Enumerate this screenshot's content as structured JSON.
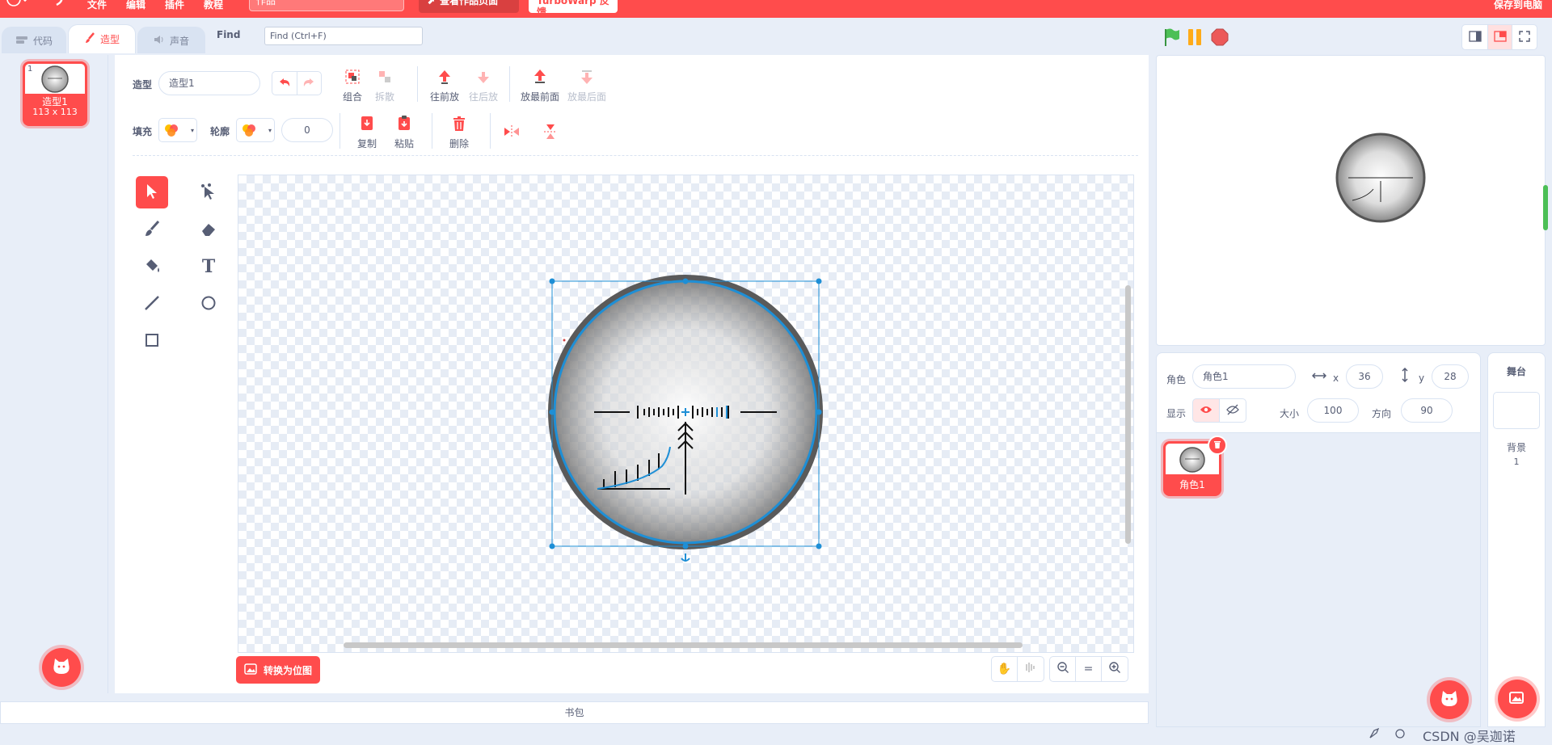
{
  "menu": {
    "items": [
      "文件",
      "编辑",
      "插件",
      "教程"
    ],
    "project_title": "作品",
    "see_project_label": "查看作品页面",
    "feedback_label": "TurboWarp 反馈",
    "save_label": "保存到电脑",
    "accent_color": "#ff4c4c"
  },
  "tabs": [
    {
      "label": "代码",
      "icon": "code-icon"
    },
    {
      "label": "造型",
      "icon": "brush-icon",
      "active": true
    },
    {
      "label": "声音",
      "icon": "speaker-icon"
    }
  ],
  "find": {
    "label": "Find",
    "placeholder": "Find (Ctrl+F)"
  },
  "costumes": [
    {
      "index": "1",
      "name": "造型1",
      "size": "113 x 113"
    }
  ],
  "editor": {
    "costume_label": "造型",
    "costume_name": "造型1",
    "fill_label": "填充",
    "outline_label": "轮廓",
    "outline_width": "0",
    "group_label": "组合",
    "ungroup_label": "拆散",
    "forward_label": "往前放",
    "backward_label": "往后放",
    "front_label": "放最前面",
    "back_label": "放最后面",
    "copy_label": "复制",
    "paste_label": "粘贴",
    "delete_label": "删除",
    "convert_bitmap_label": "转换为位图"
  },
  "tools": [
    "select-icon",
    "reshape-icon",
    "brush-icon",
    "eraser-icon",
    "fill-icon",
    "text-icon",
    "line-icon",
    "circle-icon",
    "rectangle-icon"
  ],
  "backpack_label": "书包",
  "sprite": {
    "label": "角色",
    "name": "角色1",
    "x_label": "x",
    "x": "36",
    "y_label": "y",
    "y": "28",
    "show_label": "显示",
    "size_label": "大小",
    "size": "100",
    "direction_label": "方向",
    "direction": "90"
  },
  "sprite_list": [
    {
      "name": "角色1"
    }
  ],
  "stage_pane": {
    "title": "舞台",
    "backdrops_label": "背景",
    "backdrops_count": "1"
  },
  "watermark": "CSDN @吴迦诺"
}
